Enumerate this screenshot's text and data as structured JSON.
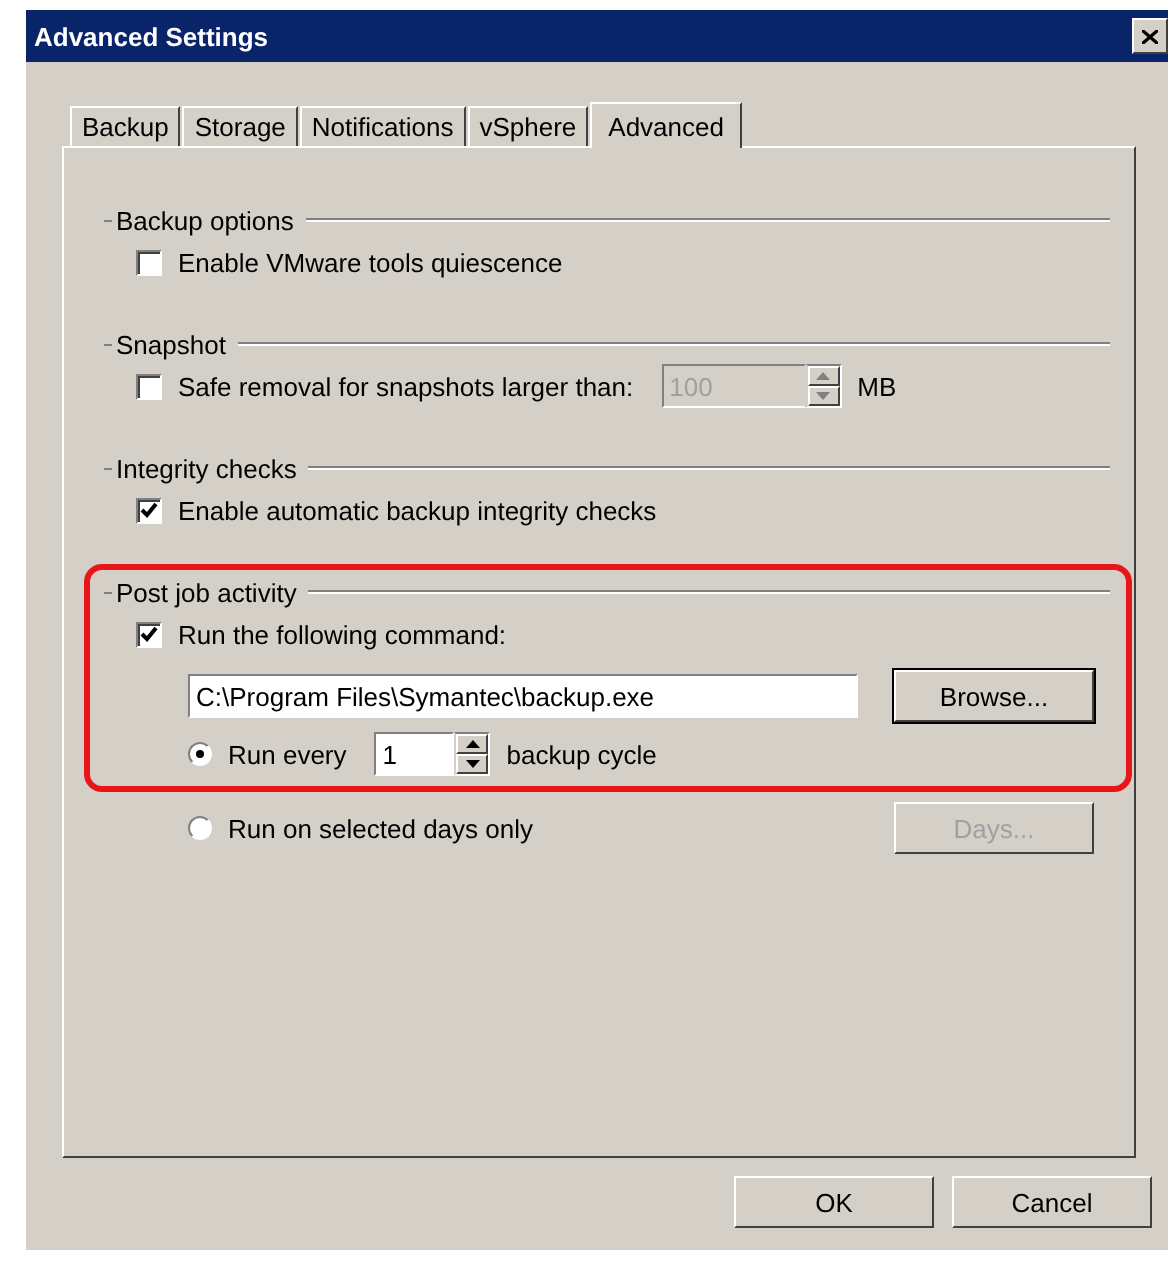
{
  "window": {
    "title": "Advanced Settings"
  },
  "tabs": [
    {
      "label": "Backup",
      "selected": false
    },
    {
      "label": "Storage",
      "selected": false
    },
    {
      "label": "Notifications",
      "selected": false
    },
    {
      "label": "vSphere",
      "selected": false
    },
    {
      "label": "Advanced",
      "selected": true
    }
  ],
  "groups": [
    {
      "title": "Backup options",
      "items": [
        {
          "kind": "checkbox",
          "label": "Enable VMware tools quiescence",
          "checked": false
        }
      ]
    },
    {
      "title": "Snapshot",
      "items": [
        {
          "kind": "checkbox",
          "label": "Safe removal for snapshots larger than:",
          "checked": false,
          "spin": {
            "value": "100",
            "disabled": true
          },
          "suffix": "MB"
        }
      ]
    },
    {
      "title": "Integrity checks",
      "items": [
        {
          "kind": "checkbox",
          "label": "Enable automatic backup integrity checks",
          "checked": true
        }
      ]
    },
    {
      "title": "Post job activity",
      "highlighted": true,
      "items": [
        {
          "kind": "checkbox",
          "label": "Run the following command:",
          "checked": true
        },
        {
          "kind": "path",
          "value": "C:\\Program Files\\Symantec\\backup.exe",
          "button": {
            "label": "Browse...",
            "disabled": false
          }
        },
        {
          "kind": "radio",
          "label": "Run every",
          "selected": true,
          "spin": {
            "value": "1",
            "disabled": false
          },
          "suffix": "backup cycle"
        }
      ]
    },
    {
      "items": [
        {
          "kind": "radio",
          "label": "Run on selected days only",
          "selected": false,
          "button": {
            "label": "Days...",
            "disabled": true
          }
        }
      ]
    }
  ],
  "buttons": [
    {
      "label": "OK"
    },
    {
      "label": "Cancel"
    }
  ]
}
